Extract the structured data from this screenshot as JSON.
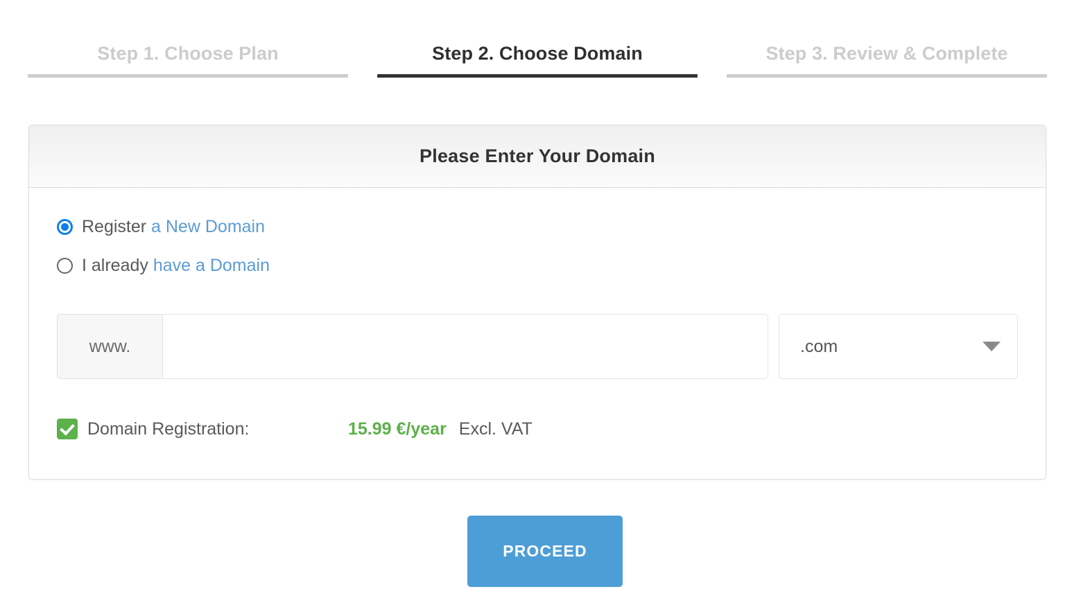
{
  "steps": [
    {
      "label": "Step 1. Choose Plan",
      "state": "inactive"
    },
    {
      "label": "Step 2. Choose Domain",
      "state": "active"
    },
    {
      "label": "Step 3. Review & Complete",
      "state": "inactive"
    }
  ],
  "panel": {
    "title": "Please Enter Your Domain",
    "options": [
      {
        "prefix": "Register ",
        "link": "a New Domain",
        "checked": true
      },
      {
        "prefix": "I already ",
        "link": "have a Domain",
        "checked": false
      }
    ],
    "domain_form": {
      "prefix_addon": "www.",
      "domain_value": "",
      "domain_placeholder": "",
      "tld_selected": ".com",
      "tld_caret_icon": "chevron-down-icon"
    },
    "registration": {
      "checkbox_checked": true,
      "checkbox_icon": "check-icon",
      "label": "Domain Registration:",
      "price": "15.99 €/year",
      "vat_note": "Excl. VAT"
    }
  },
  "actions": {
    "proceed_label": "PROCEED"
  },
  "colors": {
    "link_blue": "#5b9bd5",
    "radio_blue": "#0d7fe8",
    "price_green": "#5cb14b",
    "button_blue": "#4d9ed6",
    "active_step": "#2f2f2f",
    "inactive_step": "#cccccc"
  }
}
